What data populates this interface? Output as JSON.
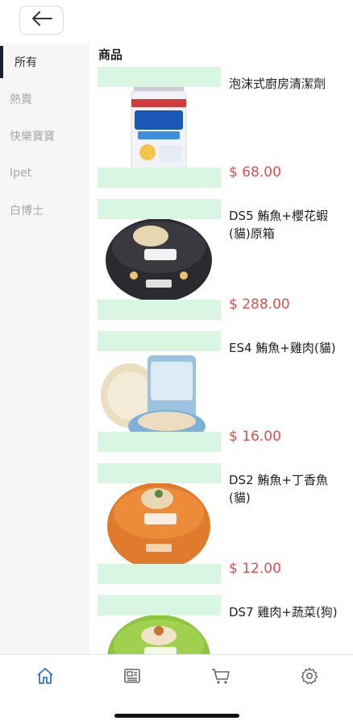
{
  "header": {
    "back_icon": "arrow-left-icon"
  },
  "sidebar": {
    "items": [
      {
        "label": "所有",
        "active": true
      },
      {
        "label": "熱賣",
        "active": false
      },
      {
        "label": "快樂寶寶",
        "active": false
      },
      {
        "label": "Ipet",
        "active": false
      },
      {
        "label": "白博士",
        "active": false
      }
    ]
  },
  "main": {
    "section_title": "商品",
    "products": [
      {
        "name": "泡沫式廚房清潔劑",
        "price": "$ 68.00",
        "image": "cleaning-spray-can"
      },
      {
        "name": "DS5 鮪魚+櫻花蝦(貓)原箱",
        "price": "$ 288.00",
        "image": "black-pet-food-can"
      },
      {
        "name": "ES4 鮪魚+雞肉(貓)",
        "price": "$ 16.00",
        "image": "blue-pet-food-can"
      },
      {
        "name": "DS2 鮪魚+丁香魚(貓)",
        "price": "$ 12.00",
        "image": "orange-pet-food-can"
      },
      {
        "name": "DS7 雞肉+蔬菜(狗)",
        "price": "",
        "image": "green-pet-food-can"
      }
    ]
  },
  "bottom_nav": {
    "items": [
      {
        "icon": "home-icon",
        "active": true
      },
      {
        "icon": "news-icon",
        "active": false
      },
      {
        "icon": "cart-icon",
        "active": false
      },
      {
        "icon": "settings-icon",
        "active": false
      }
    ]
  },
  "colors": {
    "accent": "#2f6fe0",
    "price": "#e94a4a",
    "sidebar_bg": "#f6f6f7",
    "active_bar": "#172036",
    "mask": "#d8f6e2"
  }
}
